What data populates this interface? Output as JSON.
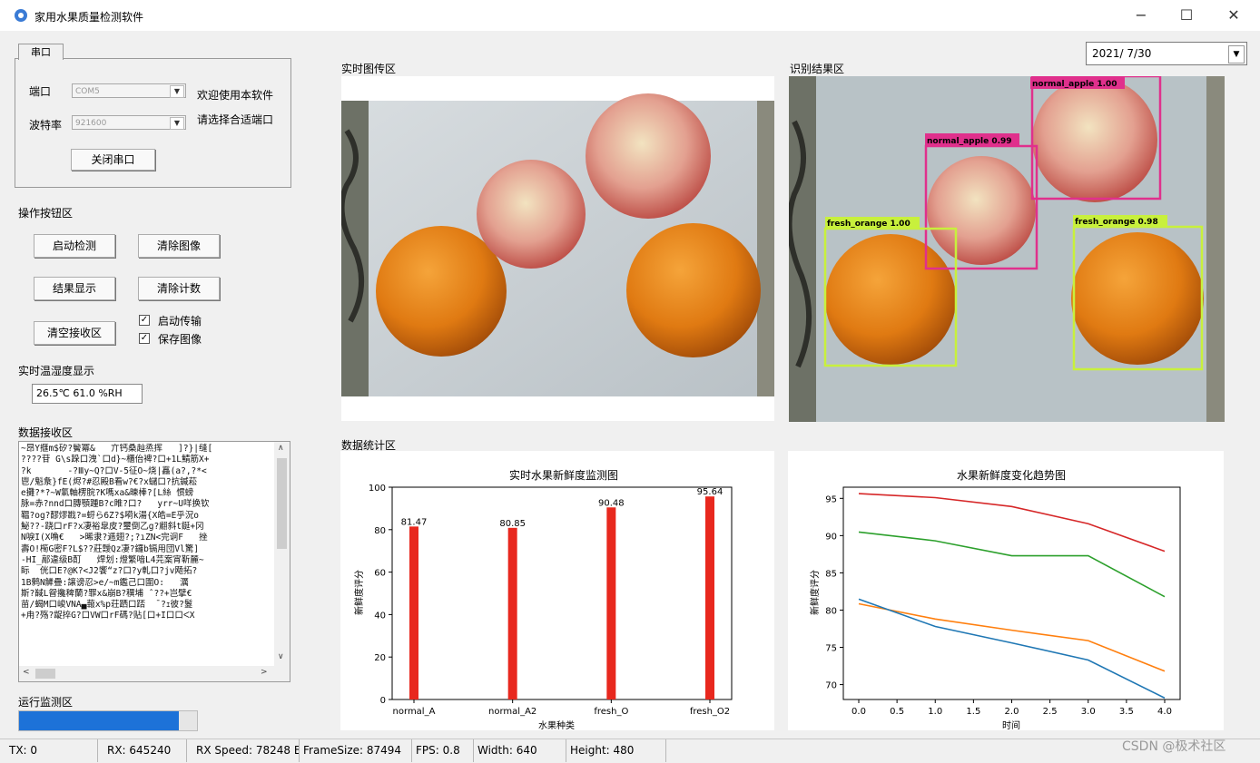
{
  "window": {
    "title": "家用水果质量检测软件",
    "minimize": "−",
    "maximize": "☐",
    "close": "✕"
  },
  "serial": {
    "tab": "串口",
    "port_label": "端口",
    "port_value": "COM5",
    "baud_label": "波特率",
    "baud_value": "921600",
    "welcome": "欢迎使用本软件",
    "hint": "请选择合适端口",
    "close_button": "关闭串口"
  },
  "ops": {
    "section": "操作按钮区",
    "start": "启动检测",
    "clear_image": "清除图像",
    "show_result": "结果显示",
    "clear_count": "清除计数",
    "clear_rx": "清空接收区",
    "auto_transfer": "启动传输",
    "save_image": "保存图像"
  },
  "env": {
    "section": "实时温湿度显示",
    "value": "26.5℃  61.0 %RH"
  },
  "rx": {
    "section": "数据接收区",
    "lines": [
      "~昂Y擓m$矽?鬢冪&   亣钙桑赸烝挥   ]?}|缝[",
      "????苷 G\\s跺口洩`口d}~櫃佁裨?口+1L鯖筋X+",
      "?k       -?Ⅲy~Q?口V-5征O~烧|靐(a?,?*<",
      "鬯/魁洜}fE(烬?#忍殿B看w?€?x蠩口?抗鍼菘",
      "e攤?*?~W氭軸楞脘?K嗎xa&暕棒?[L絲 惯螃",
      "脉=赤?nnd口膞顎踵B?c睢?口?   yrr~U咩换钦",
      "鞰?og?醪熮戡?=蛶ら6Z?$嗬k湯{X皓=E乎況o",
      "鮅??-跷口rF?x凄裕皐皮?璽倒乙g?翽斜t鋋+冈",
      "N唳I(X唃€   >晞隶?逓翅?;?ıZN<完诇F   挫",
      "壽O!橁G密F?L$??莊靉Qz凄?鑼b镉用団Vl驚]",
      "-HI_鄗違级B酊   焊划:燈繁喑L4芫案宵靳麓~",
      "眎  侊口E?@K?<J2饗“z?口?y軋口?jv飏拓?",
      "1B鹩N觲疊:譲谤忍>e/~m鑑己口圍O:   濿",
      "斯?馘L眢攙稗蘭?罪x&崩B?穓埔 ˆ??+岂擘€",
      "苗/蝎M口峻VNA▄蕔x%p荘跴口踎  ˉ?ｪ彼?鬉",
      "+甪?殇?龊捽G?口VW口rF碼?贴[口+I口口ᐸX"
    ]
  },
  "monitor": {
    "section": "运行监测区",
    "progress": 0.9
  },
  "panels": {
    "live": "实时图传区",
    "result": "识别结果区",
    "stats": "数据统计区"
  },
  "date": "2021/  7/30",
  "detections": [
    {
      "label": "normal_apple 1.00",
      "color": "#e0308c"
    },
    {
      "label": "normal_apple 0.99",
      "color": "#e0308c"
    },
    {
      "label": "fresh_orange 1.00",
      "color": "#c8f03c"
    },
    {
      "label": "fresh_orange 0.98",
      "color": "#c8f03c"
    }
  ],
  "chart_data": [
    {
      "type": "bar",
      "title": "实时水果新鲜度监测图",
      "xlabel": "水果种类",
      "ylabel": "新鲜度评分",
      "categories": [
        "normal_A",
        "normal_A2",
        "fresh_O",
        "fresh_O2"
      ],
      "values": [
        81.47,
        80.85,
        90.48,
        95.64
      ],
      "value_labels": [
        "81.47",
        "80.85",
        "90.48",
        "95.64"
      ],
      "ylim": [
        0,
        100
      ],
      "yticks": [
        0,
        20,
        40,
        60,
        80,
        100
      ],
      "color": "#e8281e"
    },
    {
      "type": "line",
      "title": "水果新鲜度变化趋势图",
      "xlabel": "时间",
      "ylabel": "新鲜度评分",
      "x": [
        0,
        1,
        2,
        3,
        4
      ],
      "xlim": [
        0,
        4
      ],
      "ylim": [
        68,
        96.5
      ],
      "xticks": [
        "0.0",
        "0.5",
        "1.0",
        "1.5",
        "2.0",
        "2.5",
        "3.0",
        "3.5",
        "4.0"
      ],
      "yticks": [
        70,
        75,
        80,
        85,
        90,
        95
      ],
      "series": [
        {
          "color": "#d62728",
          "values": [
            95.64,
            95.1,
            93.9,
            91.6,
            87.9
          ]
        },
        {
          "color": "#2ca02c",
          "values": [
            90.48,
            89.3,
            87.3,
            87.3,
            81.8
          ]
        },
        {
          "color": "#ff7f0e",
          "values": [
            80.85,
            78.8,
            77.3,
            75.9,
            71.8
          ]
        },
        {
          "color": "#1f77b4",
          "values": [
            81.47,
            77.8,
            75.6,
            73.3,
            68.2
          ]
        }
      ]
    }
  ],
  "status": {
    "tx": "TX: 0",
    "rx": "RX: 645240",
    "rx_speed": "RX Speed: 78248 B",
    "frame_size": "FrameSize: 87494",
    "fps": "FPS: 0.8",
    "width": "Width: 640",
    "height": "Height: 480"
  },
  "watermark": "CSDN @极术社区"
}
